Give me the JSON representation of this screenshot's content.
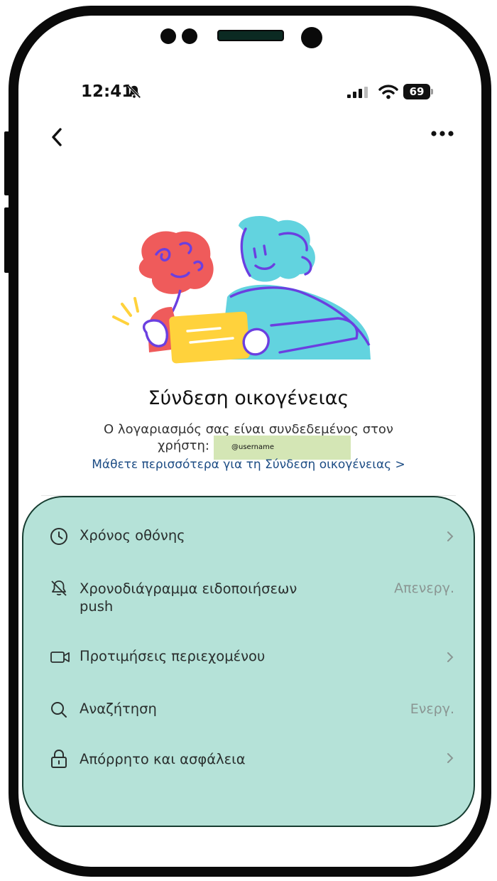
{
  "status_bar": {
    "time": "12:41",
    "battery": "69"
  },
  "page": {
    "title": "Σύνδεση οικογένειας",
    "description_line1": "Ο λογαριασμός σας είναι συνδεδεμένος στον",
    "description_line2": "χρήστη:",
    "username": "@username",
    "learn_more": "Μάθετε περισσότερα για τη Σύνδεση οικογένειας >"
  },
  "settings": [
    {
      "label": "Χρόνος οθόνης",
      "icon": "clock-icon",
      "value": "",
      "chevron": true
    },
    {
      "label": "Χρονοδιάγραμμα ειδοποιήσεων push",
      "label_line1": "Χρονοδιάγραμμα ειδοποιήσεων",
      "label_line2": "push",
      "icon": "bell-off-icon",
      "value": "Απενεργ.",
      "chevron": false
    },
    {
      "label": "Προτιμήσεις περιεχομένου",
      "icon": "video-camera-icon",
      "value": "",
      "chevron": true
    },
    {
      "label": "Αναζήτηση",
      "icon": "search-icon",
      "value": "Ενεργ.",
      "chevron": false
    },
    {
      "label": "Απόρρητο και ασφάλεια",
      "icon": "lock-icon",
      "value": "",
      "chevron": true
    }
  ],
  "colors": {
    "panel_background": "#b5e2d8",
    "panel_border": "#163c30",
    "link": "#1c4c84",
    "username_highlight": "#d4e6b5"
  }
}
